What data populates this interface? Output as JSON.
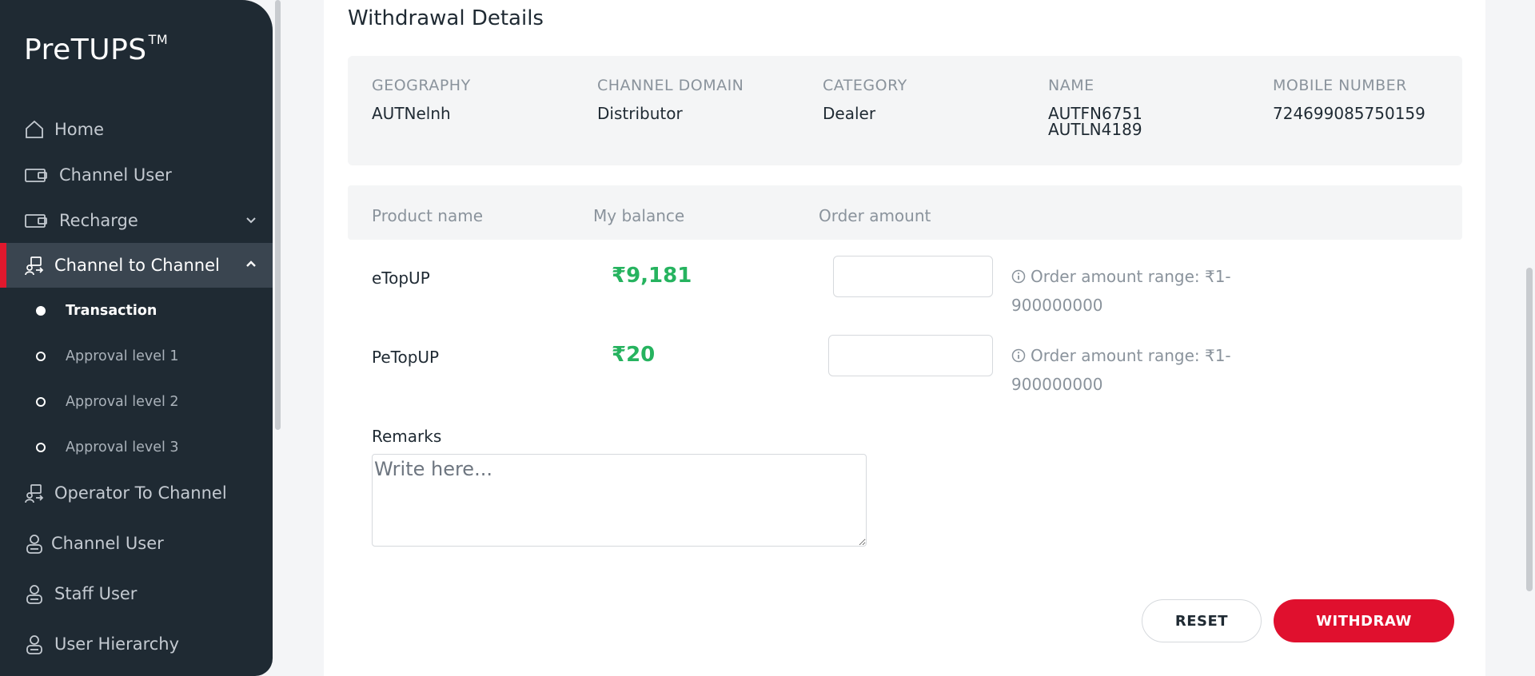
{
  "app": {
    "logo": "PreTUPS",
    "logo_tm": "TM"
  },
  "sidebar": {
    "items": [
      {
        "label": "Home",
        "icon": "home-icon"
      },
      {
        "label": "Channel User",
        "icon": "card-icon"
      },
      {
        "label": "Recharge",
        "icon": "card-icon",
        "expandable": true
      },
      {
        "label": "Channel to Channel",
        "icon": "transfer-icon",
        "expandable": true,
        "active": true
      },
      {
        "label": "Operator To Channel",
        "icon": "transfer-icon"
      },
      {
        "label": "Channel User",
        "icon": "user-icon"
      },
      {
        "label": "Staff User",
        "icon": "user-icon"
      },
      {
        "label": "User Hierarchy",
        "icon": "user-icon"
      }
    ],
    "sub_items": [
      {
        "label": "Transaction",
        "current": true
      },
      {
        "label": "Approval level 1"
      },
      {
        "label": "Approval level 2"
      },
      {
        "label": "Approval level 3"
      }
    ]
  },
  "main": {
    "section_title": "Withdrawal Details",
    "info": {
      "geography_label": "GEOGRAPHY",
      "geography_value": "AUTNelnh",
      "domain_label": "CHANNEL DOMAIN",
      "domain_value": "Distributor",
      "category_label": "CATEGORY",
      "category_value": "Dealer",
      "name_label": "NAME",
      "name_line1": "AUTFN6751",
      "name_line2": "AUTLN4189",
      "mobile_label": "MOBILE NUMBER",
      "mobile_value": "724699085750159"
    },
    "table": {
      "headers": [
        "Product name",
        "My balance",
        "Order amount"
      ],
      "rows": [
        {
          "product": "eTopUP",
          "balance": "₹9,181",
          "order_amount": "",
          "hint": "Order amount range: ₹1-900000000"
        },
        {
          "product": "PeTopUP",
          "balance": "₹20",
          "order_amount": "",
          "hint": "Order amount range: ₹1-900000000"
        }
      ]
    },
    "remarks": {
      "label": "Remarks",
      "placeholder": "Write here...",
      "value": ""
    },
    "buttons": {
      "reset": "RESET",
      "withdraw": "WITHDRAW"
    }
  },
  "colors": {
    "sidebar_bg": "#1f2a33",
    "active_bg": "#3a4550",
    "accent_red": "#e0102e",
    "balance_green": "#26b35f"
  }
}
